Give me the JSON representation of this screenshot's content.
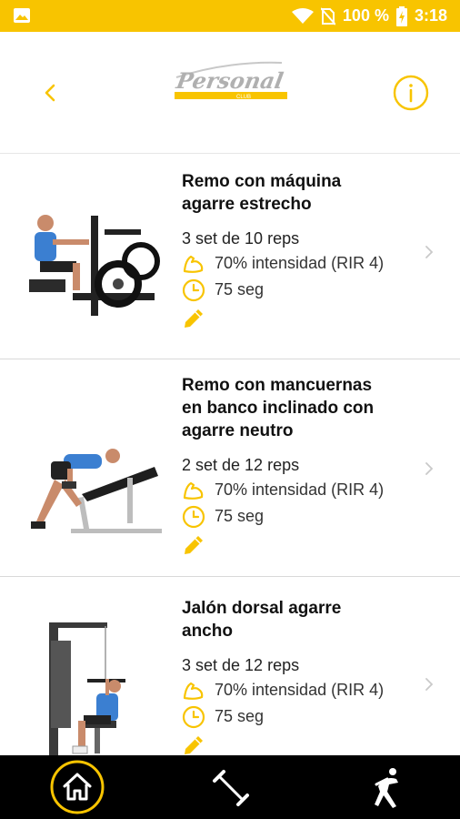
{
  "status_bar": {
    "battery_label": "100 %",
    "time": "3:18",
    "icons": [
      "image-notification-icon",
      "wifi-icon",
      "no-sim-icon",
      "battery-charging-icon"
    ]
  },
  "header": {
    "logo_text": "Personal",
    "logo_subtext": "CLUB",
    "back_icon": "chevron-left-icon",
    "info_icon": "info-circle-icon"
  },
  "colors": {
    "accent": "#f8c400",
    "nav_background": "#000000"
  },
  "exercises": [
    {
      "title_line1": "Remo con máquina",
      "title_line2": "agarre estrecho",
      "title_line3": "",
      "sets": "3 set de 10 reps",
      "intensity": "70% intensidad (RIR 4)",
      "rest": "75 seg"
    },
    {
      "title_line1": "Remo con mancuernas",
      "title_line2": "en banco inclinado con",
      "title_line3": "agarre neutro",
      "sets": "2 set de 12 reps",
      "intensity": "70% intensidad (RIR 4)",
      "rest": "75 seg"
    },
    {
      "title_line1": "Jalón dorsal agarre",
      "title_line2": "ancho",
      "title_line3": "",
      "sets": "3 set de 12 reps",
      "intensity": "70% intensidad (RIR 4)",
      "rest": "75 seg"
    }
  ],
  "bottom_nav": {
    "items": [
      "home-icon",
      "dumbbell-icon",
      "stretch-icon"
    ],
    "active": "home-icon"
  }
}
